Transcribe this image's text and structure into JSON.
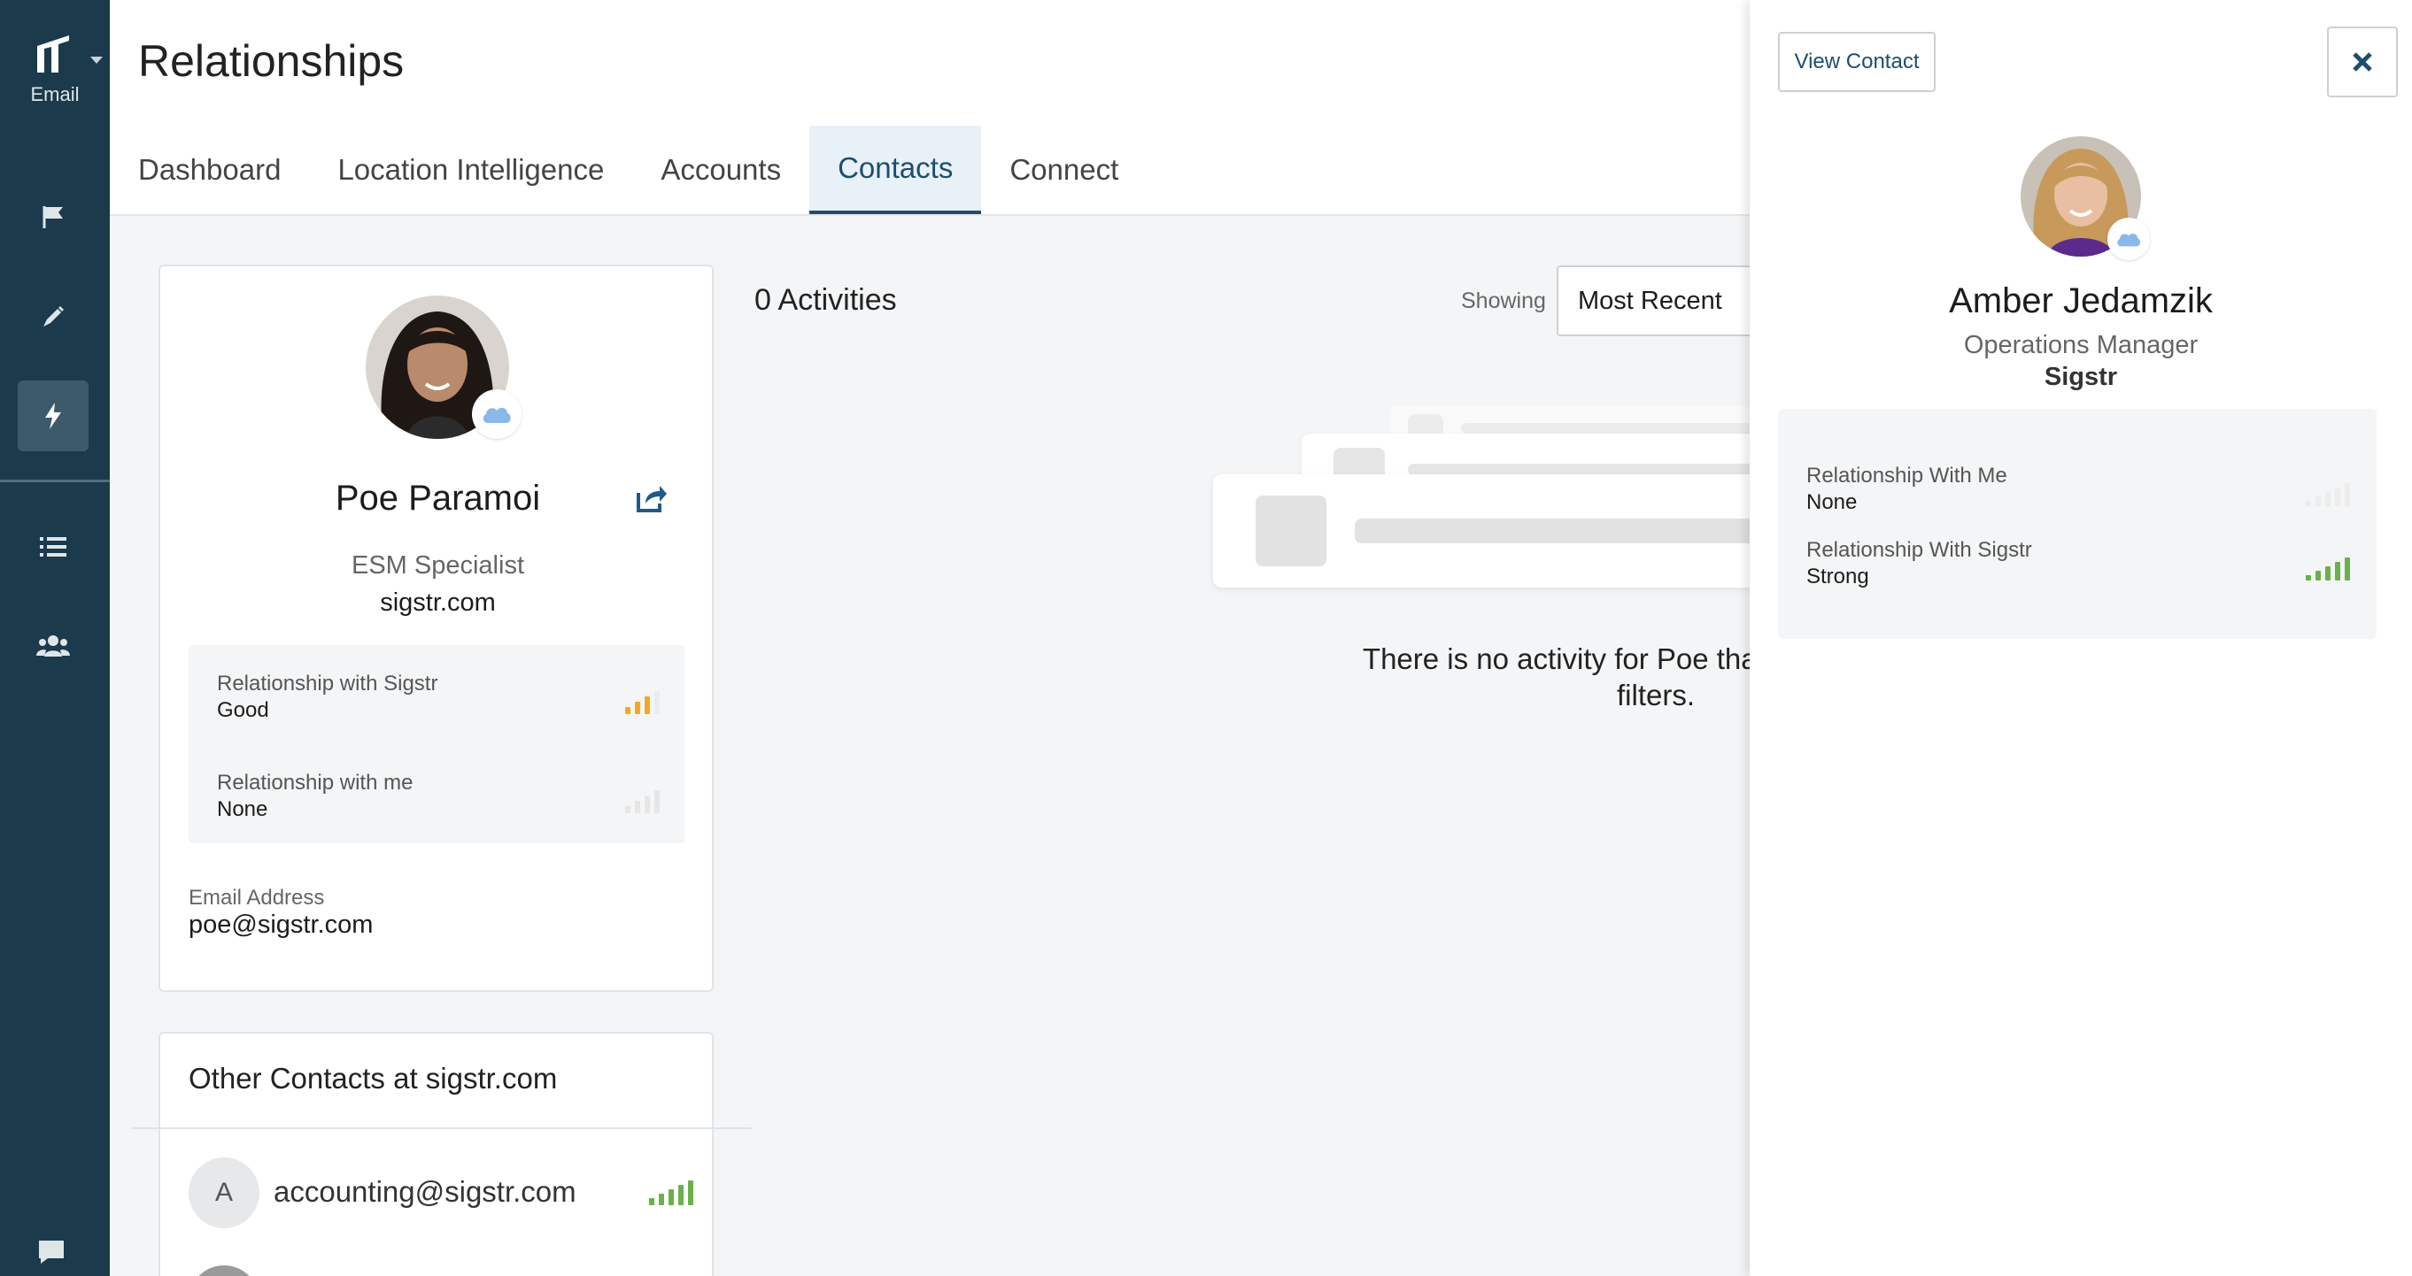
{
  "sidebar": {
    "logo_label": "Email",
    "items": [
      {
        "icon": "flag-icon"
      },
      {
        "icon": "pen-icon"
      },
      {
        "icon": "bolt-icon",
        "active": true
      },
      {
        "icon": "list-icon"
      },
      {
        "icon": "users-icon"
      },
      {
        "icon": "chat-icon"
      }
    ]
  },
  "header": {
    "title": "Relationships",
    "tabs": [
      {
        "label": "Dashboard"
      },
      {
        "label": "Location Intelligence"
      },
      {
        "label": "Accounts"
      },
      {
        "label": "Contacts",
        "active": true
      },
      {
        "label": "Connect"
      }
    ]
  },
  "profile": {
    "name": "Poe Paramoi",
    "title": "ESM Specialist",
    "domain": "sigstr.com",
    "relationships": [
      {
        "label": "Relationship with Sigstr",
        "value": "Good",
        "strength": 3,
        "color": "#f5a623"
      },
      {
        "label": "Relationship with me",
        "value": "None",
        "strength": 0,
        "color": "#cfcfcf"
      }
    ],
    "email_label": "Email Address",
    "email": "poe@sigstr.com"
  },
  "other_contacts": {
    "heading": "Other Contacts at sigstr.com",
    "items": [
      {
        "initial": "A",
        "email": "accounting@sigstr.com",
        "strength": 5,
        "color": "#6ab04c"
      }
    ]
  },
  "activities": {
    "count_label": "0 Activities",
    "showing_label": "Showing",
    "sort_value": "Most Recent",
    "empty_message": "There is no activity for Poe that matches your filters."
  },
  "drawer": {
    "view_contact_label": "View Contact",
    "name": "Amber Jedamzik",
    "title": "Operations Manager",
    "company": "Sigstr",
    "relationships": [
      {
        "label": "Relationship With Me",
        "value": "None",
        "strength": 0,
        "color": "#d8d8d8"
      },
      {
        "label": "Relationship With Sigstr",
        "value": "Strong",
        "strength": 5,
        "color": "#6ab04c"
      }
    ]
  }
}
